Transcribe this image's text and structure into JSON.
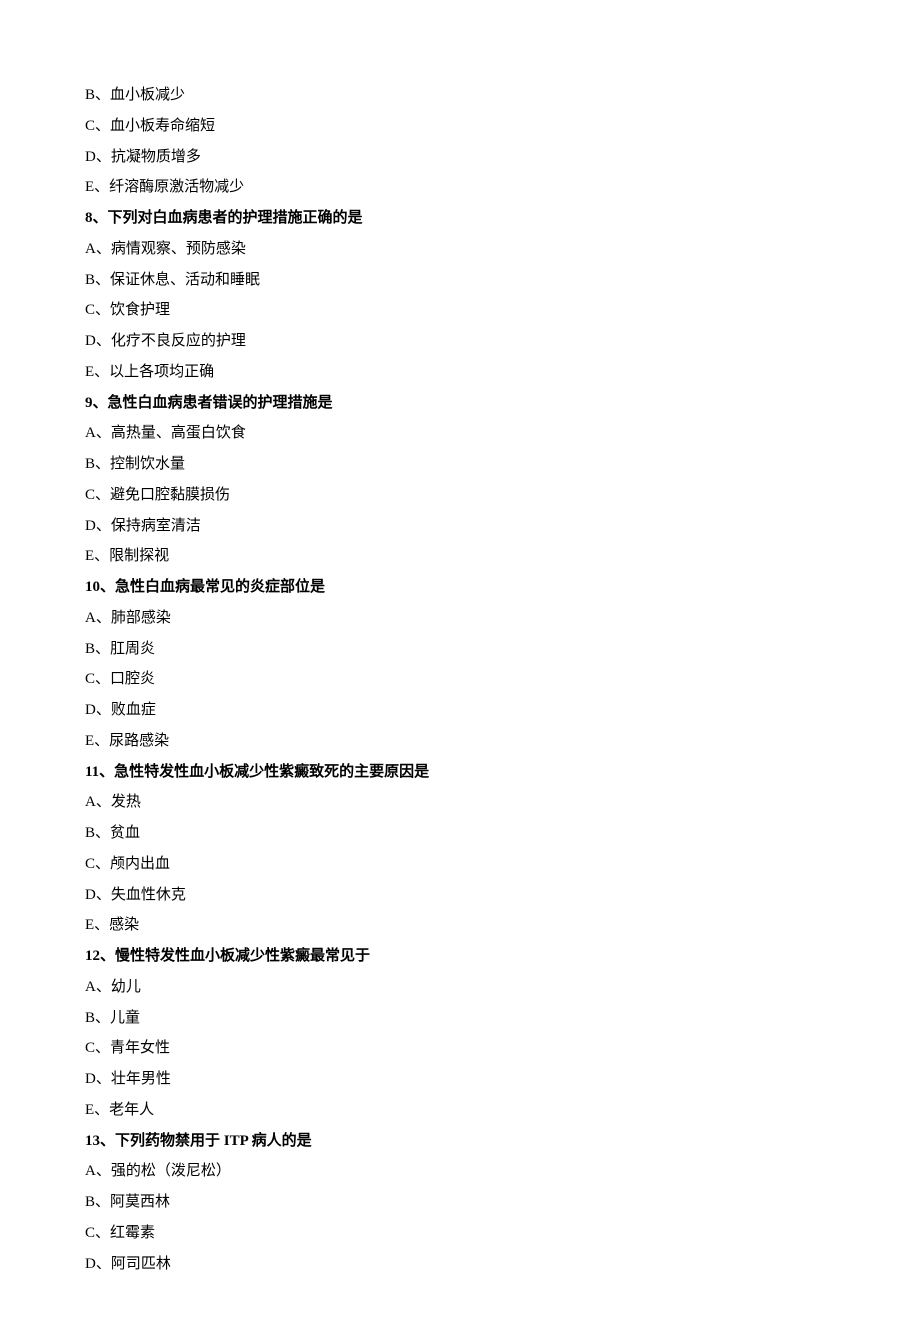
{
  "lines": [
    {
      "text": "B、血小板减少",
      "bold": false
    },
    {
      "text": "C、血小板寿命缩短",
      "bold": false
    },
    {
      "text": "D、抗凝物质增多",
      "bold": false
    },
    {
      "text": "E、纤溶酶原激活物减少",
      "bold": false
    },
    {
      "text": "8、下列对白血病患者的护理措施正确的是",
      "bold": true
    },
    {
      "text": "A、病情观察、预防感染",
      "bold": false
    },
    {
      "text": "B、保证休息、活动和睡眠",
      "bold": false
    },
    {
      "text": "C、饮食护理",
      "bold": false
    },
    {
      "text": "D、化疗不良反应的护理",
      "bold": false
    },
    {
      "text": "E、以上各项均正确",
      "bold": false
    },
    {
      "text": "9、急性白血病患者错误的护理措施是",
      "bold": true
    },
    {
      "text": "A、高热量、高蛋白饮食",
      "bold": false
    },
    {
      "text": "B、控制饮水量",
      "bold": false
    },
    {
      "text": "C、避免口腔黏膜损伤",
      "bold": false
    },
    {
      "text": "D、保持病室清洁",
      "bold": false
    },
    {
      "text": "E、限制探视",
      "bold": false
    },
    {
      "text": "10、急性白血病最常见的炎症部位是",
      "bold": true
    },
    {
      "text": "A、肺部感染",
      "bold": false
    },
    {
      "text": "B、肛周炎",
      "bold": false
    },
    {
      "text": "C、口腔炎",
      "bold": false
    },
    {
      "text": "D、败血症",
      "bold": false
    },
    {
      "text": "E、尿路感染",
      "bold": false
    },
    {
      "text": "11、急性特发性血小板减少性紫癜致死的主要原因是",
      "bold": true
    },
    {
      "text": "A、发热",
      "bold": false
    },
    {
      "text": "B、贫血",
      "bold": false
    },
    {
      "text": "C、颅内出血",
      "bold": false
    },
    {
      "text": "D、失血性休克",
      "bold": false
    },
    {
      "text": "E、感染",
      "bold": false
    },
    {
      "text": "12、慢性特发性血小板减少性紫癜最常见于",
      "bold": true
    },
    {
      "text": "A、幼儿",
      "bold": false
    },
    {
      "text": "B、儿童",
      "bold": false
    },
    {
      "text": "C、青年女性",
      "bold": false
    },
    {
      "text": "D、壮年男性",
      "bold": false
    },
    {
      "text": "E、老年人",
      "bold": false
    },
    {
      "text": "13、下列药物禁用于 ITP 病人的是",
      "bold": true
    },
    {
      "text": "A、强的松（泼尼松）",
      "bold": false
    },
    {
      "text": "B、阿莫西林",
      "bold": false
    },
    {
      "text": "C、红霉素",
      "bold": false
    },
    {
      "text": "D、阿司匹林",
      "bold": false
    }
  ]
}
